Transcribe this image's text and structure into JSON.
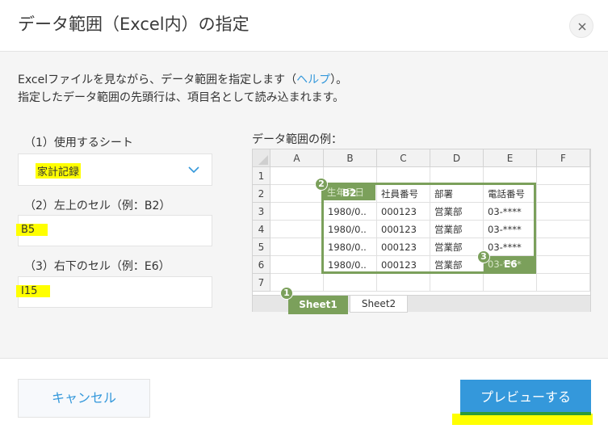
{
  "dialog": {
    "title": "データ範囲（Excel内）の指定",
    "close_label": "×"
  },
  "description": {
    "line1_before": "Excelファイルを見ながら、データ範囲を指定します（",
    "help_link": "ヘルプ",
    "line1_after": "）。",
    "line2": "指定したデータ範囲の先頭行は、項目名として読み込まれます。"
  },
  "fields": {
    "sheet_label": "（1）使用するシート",
    "sheet_value": "家計記録",
    "top_left_label": "（2）左上のセル（例：B2）",
    "top_left_value": "B5",
    "bottom_right_label": "（3）右下のセル（例：E6）",
    "bottom_right_value": "I15"
  },
  "example": {
    "label": "データ範囲の例：",
    "columns": [
      "A",
      "B",
      "C",
      "D",
      "E",
      "F"
    ],
    "rows": [
      "1",
      "2",
      "3",
      "4",
      "5",
      "6",
      "7"
    ],
    "header_row": [
      "生年月日",
      "社員番号",
      "部署",
      "電話番号"
    ],
    "data_rows": [
      [
        "1980/0..",
        "000123",
        "営業部",
        "03-****"
      ],
      [
        "1980/0..",
        "000123",
        "営業部",
        "03-****"
      ],
      [
        "1980/0..",
        "000123",
        "営業部",
        "03-****"
      ],
      [
        "1980/0..",
        "000123",
        "営業部",
        "03-****"
      ]
    ],
    "start_cell_label": "B2",
    "end_cell_label": "E6",
    "badges": [
      "1",
      "2",
      "3"
    ],
    "tabs": [
      "Sheet1",
      "Sheet2"
    ]
  },
  "footer": {
    "cancel_label": "キャンセル",
    "preview_label": "プレビューする"
  },
  "colors": {
    "accent": "#3498db",
    "example_green": "#7ba05b",
    "highlight": "#ffff00"
  }
}
